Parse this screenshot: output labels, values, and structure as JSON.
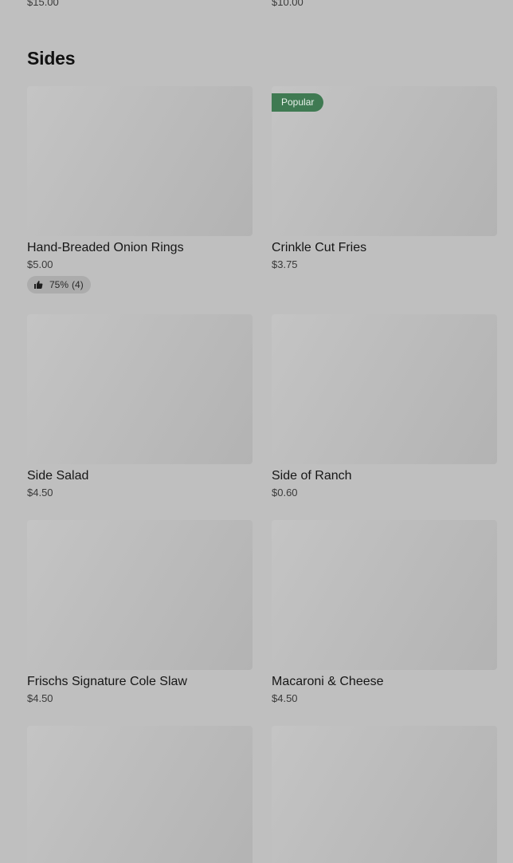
{
  "top_prices": [
    "$15.00",
    "$10.00"
  ],
  "section": {
    "title": "Sides"
  },
  "items": [
    {
      "name": "Hand-Breaded Onion Rings",
      "price": "$5.00",
      "rating": {
        "percent": "75%",
        "count": "(4)"
      },
      "icon": "thumbs-up-icon"
    },
    {
      "name": "Crinkle Cut Fries",
      "price": "$3.75",
      "badge": "Popular"
    },
    {
      "name": "Side Salad",
      "price": "$4.50"
    },
    {
      "name": "Side of Ranch",
      "price": "$0.60"
    },
    {
      "name": "Frischs Signature Cole Slaw",
      "price": "$4.50"
    },
    {
      "name": "Macaroni & Cheese",
      "price": "$4.50"
    }
  ],
  "colors": {
    "background": "#bfbfbf",
    "badge": "#3f7a52",
    "rating_pill": "#acacac"
  }
}
